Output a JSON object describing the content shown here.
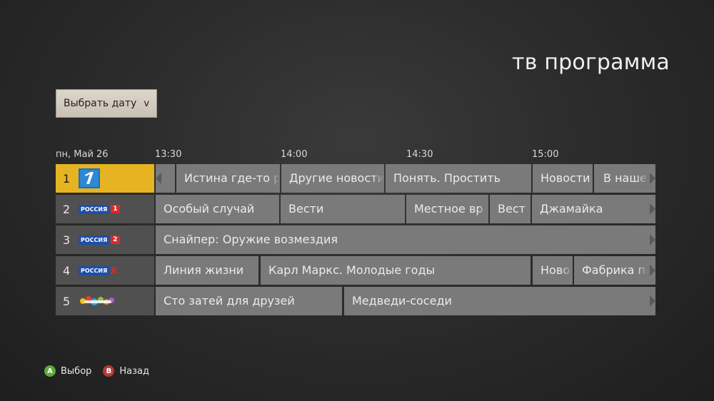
{
  "page": {
    "title": "тв программа"
  },
  "date_button": {
    "label": "Выбрать дату",
    "chevron": "v"
  },
  "guide": {
    "date": "пн, Май 26",
    "times": [
      "13:30",
      "14:00",
      "14:30",
      "15:00"
    ],
    "channels": [
      {
        "number": "1",
        "logo": "pervy-kanal-logo-icon",
        "selected": true,
        "programs": [
          "",
          "Истина где-то р",
          "Другие новости",
          "Понять. Простить",
          "Новости",
          "В наше в"
        ]
      },
      {
        "number": "2",
        "logo": "rossiya-1-logo-icon",
        "logo_text": "РОССИЯ",
        "logo_badge": "1",
        "programs": [
          "Особый случай",
          "Вести",
          "Местное вр",
          "Вест",
          "Джамайка"
        ]
      },
      {
        "number": "3",
        "logo": "rossiya-2-logo-icon",
        "logo_text": "РОССИЯ",
        "logo_badge": "2",
        "programs": [
          "Снайпер: Оружие возмездия"
        ]
      },
      {
        "number": "4",
        "logo": "rossiya-k-logo-icon",
        "logo_text": "РОССИЯ",
        "logo_badge": "К",
        "programs": [
          "Линия жизни",
          "Карл Маркс. Молодые годы",
          "Ново",
          "Фабрика па"
        ]
      },
      {
        "number": "5",
        "logo": "karusel-logo-icon",
        "programs": [
          "Сто затей для друзей",
          "Медведи-соседи"
        ]
      }
    ]
  },
  "legend": {
    "a_key": "A",
    "a_label": "Выбор",
    "b_key": "B",
    "b_label": "Назад"
  },
  "colors": {
    "selected": "#e6b422",
    "program_tile": "#7a7a7a",
    "channel_tile": "#505050",
    "a_button": "#5fa83a",
    "b_button": "#b83a3a"
  }
}
